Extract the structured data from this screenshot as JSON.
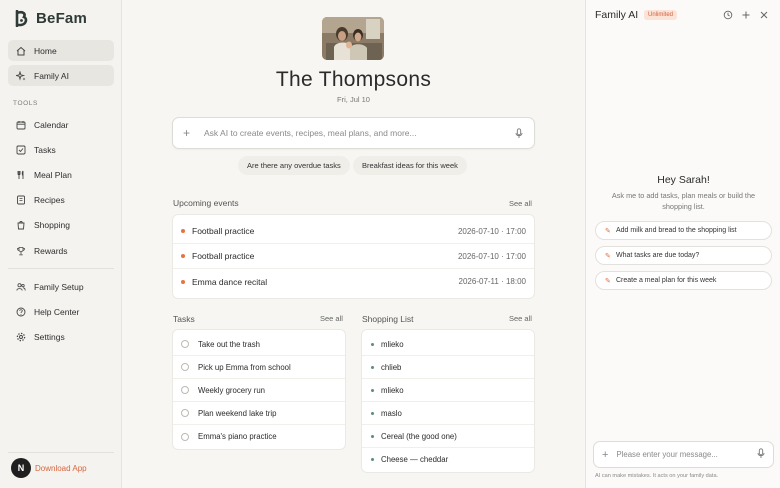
{
  "brand": {
    "name": "BeFam"
  },
  "sidebar": {
    "nav_top": [
      {
        "label": "Home",
        "icon": "home-icon"
      },
      {
        "label": "Family AI",
        "icon": "sparkle-icon"
      }
    ],
    "tools_label": "TOOLS",
    "tools": [
      {
        "label": "Calendar",
        "icon": "calendar-icon"
      },
      {
        "label": "Tasks",
        "icon": "checkbox-icon"
      },
      {
        "label": "Meal Plan",
        "icon": "utensils-icon"
      },
      {
        "label": "Recipes",
        "icon": "recipe-book-icon"
      },
      {
        "label": "Shopping",
        "icon": "shopping-bag-icon"
      },
      {
        "label": "Rewards",
        "icon": "trophy-icon"
      }
    ],
    "bottom": [
      {
        "label": "Family Setup",
        "icon": "users-icon"
      },
      {
        "label": "Help Center",
        "icon": "help-icon"
      },
      {
        "label": "Settings",
        "icon": "gear-icon"
      }
    ],
    "download_label": "Download App",
    "avatar_letter": "N"
  },
  "main": {
    "family_name": "The Thompsons",
    "date": "Fri, Jul 10",
    "ask_placeholder": "Ask AI to create events, recipes, meal plans, and more...",
    "chips": [
      "Are there any overdue tasks",
      "Breakfast ideas for this week"
    ],
    "upcoming": {
      "title": "Upcoming events",
      "see_all": "See all",
      "items": [
        {
          "title": "Football practice",
          "when": "2026-07-10 · 17:00"
        },
        {
          "title": "Football practice",
          "when": "2026-07-10 · 17:00"
        },
        {
          "title": "Emma dance recital",
          "when": "2026-07-11 · 18:00"
        }
      ]
    },
    "tasks": {
      "title": "Tasks",
      "see_all": "See all",
      "items": [
        "Take out the trash",
        "Pick up Emma from school",
        "Weekly grocery run",
        "Plan weekend lake trip",
        "Emma's piano practice"
      ]
    },
    "shopping": {
      "title": "Shopping List",
      "see_all": "See all",
      "items": [
        "mlieko",
        "chlieb",
        "mlieko",
        "maslo",
        "Cereal (the good one)",
        "Cheese — cheddar"
      ]
    }
  },
  "panel": {
    "title": "Family AI",
    "badge": "Unlimited",
    "greeting": "Hey Sarah!",
    "subtitle": "Ask me to add tasks, plan meals or build the shopping list.",
    "suggestions": [
      "Add milk and bread to the shopping list",
      "What tasks are due today?",
      "Create a meal plan for this week"
    ],
    "message_placeholder": "Please enter your message...",
    "disclaimer": "AI can make mistakes. It acts on your family data."
  },
  "colors": {
    "accent": "#e8733f",
    "brand": "#2f3b36",
    "shopping_dot": "#5c8d7a"
  }
}
